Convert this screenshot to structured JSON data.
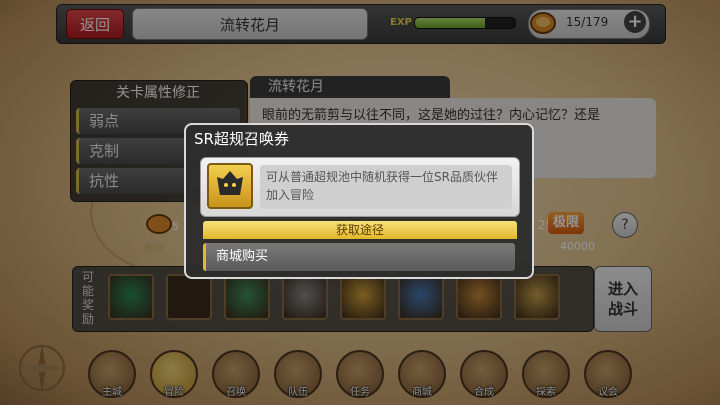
{
  "topbar": {
    "back_label": "返回",
    "title": "流转花月",
    "exp_label": "EXP",
    "exp_fraction": 0.7,
    "stamina": "15/179",
    "plus": "+"
  },
  "modifiers": {
    "header": "关卡属性修正",
    "rows": [
      "弱点",
      "克制",
      "抗性"
    ]
  },
  "stage": {
    "tab_title": "流转花月",
    "description": "眼前的无箭剪与以往不同，这是她的过往？内心记忆？还是"
  },
  "midrow": {
    "left_num": "5",
    "left_small": "推荐",
    "cost": "25",
    "difficulty": "极限",
    "power": "40000",
    "help": "?"
  },
  "rewards": {
    "label": "可能奖励",
    "slot_colors": [
      "#2a8a5a",
      "#3a2a1a",
      "#3f8f5a",
      "#8a8a8a",
      "#d4a23a",
      "#4a7ab5",
      "#c98a3a",
      "#c9a04a"
    ],
    "enter_label": "进入战斗"
  },
  "nav": {
    "items": [
      "主城",
      "冒险",
      "召唤",
      "队伍",
      "任务",
      "商城",
      "合成",
      "探索",
      "议会"
    ]
  },
  "modal": {
    "title": "SR超规召唤券",
    "item_description": "可从普通超规池中随机获得一位SR品质伙伴加入冒险",
    "source_header": "获取途径",
    "sources": [
      "商城购买"
    ]
  },
  "colors": {
    "accent_red": "#c8262a",
    "gold": "#e3b82a",
    "exp_green": "#8cc63f"
  }
}
